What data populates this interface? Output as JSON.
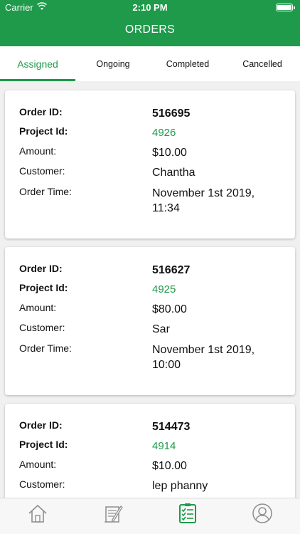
{
  "status_bar": {
    "carrier": "Carrier",
    "time": "2:10 PM"
  },
  "header": {
    "title": "ORDERS"
  },
  "tabs": [
    {
      "label": "Assigned",
      "active": true
    },
    {
      "label": "Ongoing",
      "active": false
    },
    {
      "label": "Completed",
      "active": false
    },
    {
      "label": "Cancelled",
      "active": false
    }
  ],
  "labels": {
    "order_id": "Order ID:",
    "project_id": "Project Id:",
    "amount": "Amount:",
    "customer": "Customer:",
    "order_time": "Order Time:"
  },
  "orders": [
    {
      "order_id": "516695",
      "project_id": "4926",
      "amount": "$10.00",
      "customer": "Chantha",
      "order_time_line1": "November 1st 2019,",
      "order_time_line2": "11:34"
    },
    {
      "order_id": "516627",
      "project_id": "4925",
      "amount": "$80.00",
      "customer": "Sar",
      "order_time_line1": "November 1st 2019,",
      "order_time_line2": "10:00"
    },
    {
      "order_id": "514473",
      "project_id": "4914",
      "amount": "$10.00",
      "customer": "lep phanny"
    }
  ],
  "bottom_nav": [
    {
      "icon": "home-icon",
      "active": false
    },
    {
      "icon": "document-pen-icon",
      "active": false
    },
    {
      "icon": "checklist-icon",
      "active": true
    },
    {
      "icon": "user-icon",
      "active": false
    }
  ],
  "colors": {
    "brand": "#1e9a4a",
    "inactive_icon": "#8e8e8e"
  }
}
